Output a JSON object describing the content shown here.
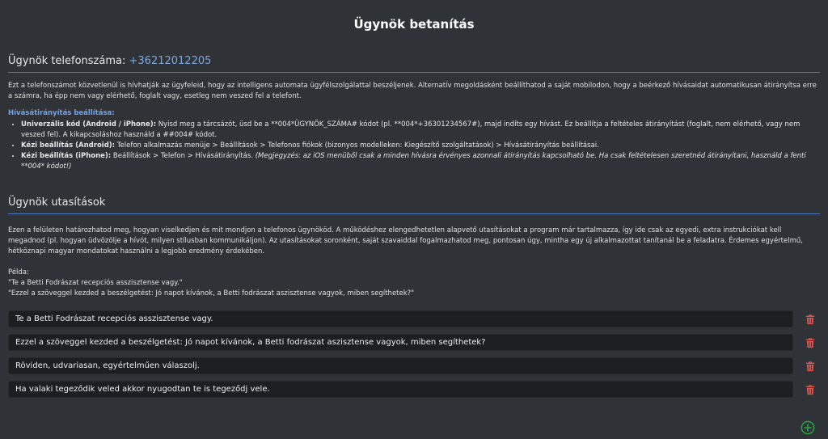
{
  "page": {
    "title": "Ügynök betanítás"
  },
  "phone_section": {
    "heading_label": "Ügynök telefonszáma:",
    "phone_number": "+36212012205",
    "intro": "Ezt a telefonszámot közvetlenül is hívhatják az ügyfeleid, hogy az intelligens automata ügyfélszolgálattal beszéljenek. Alternatív megoldásként beállíthatod a saját mobilodon, hogy a beérkező hívásaidat automatikusan átirányítsa erre a számra, ha épp nem vagy elérhető, foglalt vagy, esetleg nem veszed fel a telefont.",
    "forwarding_title": "Hívásátirányítás beállítása:",
    "methods": [
      {
        "label": "Univerzális kód (Android / iPhone):",
        "text": "Nyisd meg a tárcsázót, üsd be a **004*ÜGYNÖK_SZÁMA# kódot (pl. **004*+36301234567#), majd indíts egy hívást. Ez beállítja a feltételes átirányítást (foglalt, nem elérhető, vagy nem veszed fel). A kikapcsoláshoz használd a ##004# kódot.",
        "note": ""
      },
      {
        "label": "Kézi beállítás (Android):",
        "text": "Telefon alkalmazás menüje > Beállítások > Telefonos fiókok (bizonyos modelleken: Kiegészítő szolgáltatások) > Hívásátirányítás beállításai.",
        "note": ""
      },
      {
        "label": "Kézi beállítás (iPhone):",
        "text": "Beállítások > Telefon > Hívásátirányítás.",
        "note": "(Megjegyzés: az iOS menüből csak a minden hívásra érvényes azonnali átirányítás kapcsolható be. Ha csak feltételesen szeretnéd átirányítani, használd a fenti **004* kódot!)"
      }
    ]
  },
  "instructions_section": {
    "heading": "Ügynök utasítások",
    "description": "Ezen a felületen határozhatod meg, hogyan viselkedjen és mit mondjon a telefonos ügynököd. A működéshez elengedhetetlen alapvető utasításokat a program már tartalmazza, így ide csak az egyedi, extra instrukciókat kell megadnod (pl. hogyan üdvözölje a hívót, milyen stílusban kommunikáljon). Az utasításokat soronként, saját szavaiddal fogalmazhatod meg, pontosan úgy, mintha egy új alkalmazottat tanítanál be a feladatra. Érdemes egyértelmű, hétköznapi magyar mondatokat használni a legjobb eredmény érdekében.",
    "example_label": "Példa:",
    "example_lines": [
      "\"Te a Betti Fodrászat recepciós asszisztense vagy.\"",
      "\"Ezzel a szöveggel kezded a beszélgetést: Jó napot kívánok, a Betti fodrászat aszisztense vagyok, miben segíthetek?\""
    ],
    "instructions": [
      "Te a Betti Fodrászat recepciós asszisztense vagy.",
      "Ezzel a szöveggel kezded a beszélgetést: Jó napot kívánok, a Betti fodrászat aszisztense vagyok, miben segíthetek?",
      "Röviden, udvariasan, egyértelműen válaszolj.",
      "Ha valaki tegeződik veled akkor nyugodtan te is tegeződj vele."
    ],
    "delete_icon": "trash-icon",
    "add_icon": "plus-circle-icon"
  },
  "colors": {
    "background": "#2f3337",
    "accent": "#4a78c2",
    "phone": "#7ea6e0",
    "delete": "#d9534f",
    "add": "#28a745"
  }
}
